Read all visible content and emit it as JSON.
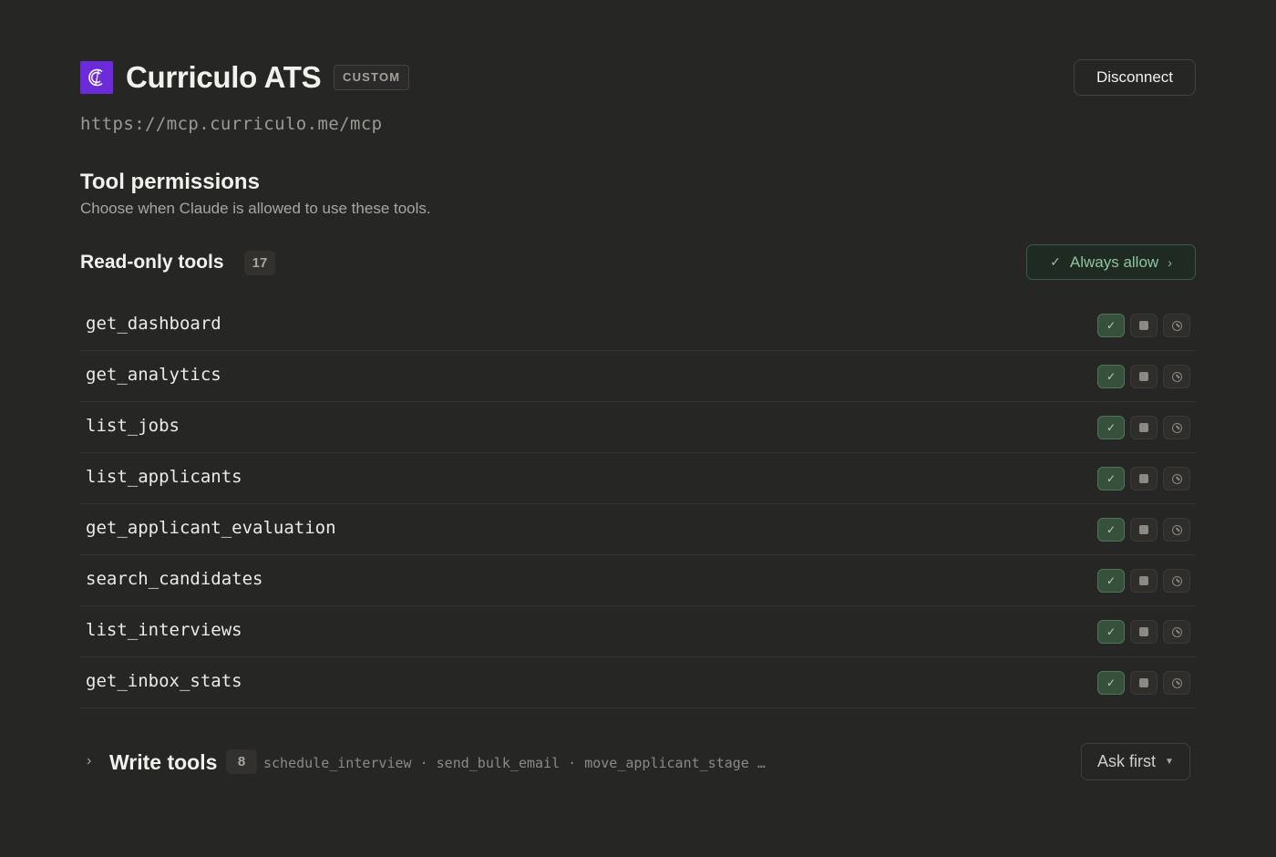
{
  "server": {
    "name": "Curriculo ATS",
    "badge": "CUSTOM",
    "url": "https://mcp.curriculo.me/mcp",
    "disconnect_label": "Disconnect",
    "logo_letter": "C",
    "logo_color": "#6b2bd9"
  },
  "permissions": {
    "title": "Tool permissions",
    "subtitle": "Choose when Claude is allowed to use these tools."
  },
  "read_only": {
    "title": "Read-only tools",
    "count": "17",
    "policy_label": "Always allow",
    "tools": [
      {
        "name": "get_dashboard",
        "permission": "allow"
      },
      {
        "name": "get_analytics",
        "permission": "allow"
      },
      {
        "name": "list_jobs",
        "permission": "allow"
      },
      {
        "name": "list_applicants",
        "permission": "allow"
      },
      {
        "name": "get_applicant_evaluation",
        "permission": "allow"
      },
      {
        "name": "search_candidates",
        "permission": "allow"
      },
      {
        "name": "list_interviews",
        "permission": "allow"
      },
      {
        "name": "get_inbox_stats",
        "permission": "allow"
      }
    ]
  },
  "write": {
    "title": "Write tools",
    "count": "8",
    "preview": "schedule_interview · send_bulk_email · move_applicant_stage …",
    "policy_label": "Ask first"
  },
  "colors": {
    "background": "#262624",
    "accent_green": "#8fc39c",
    "active_permission": "#37503c"
  }
}
